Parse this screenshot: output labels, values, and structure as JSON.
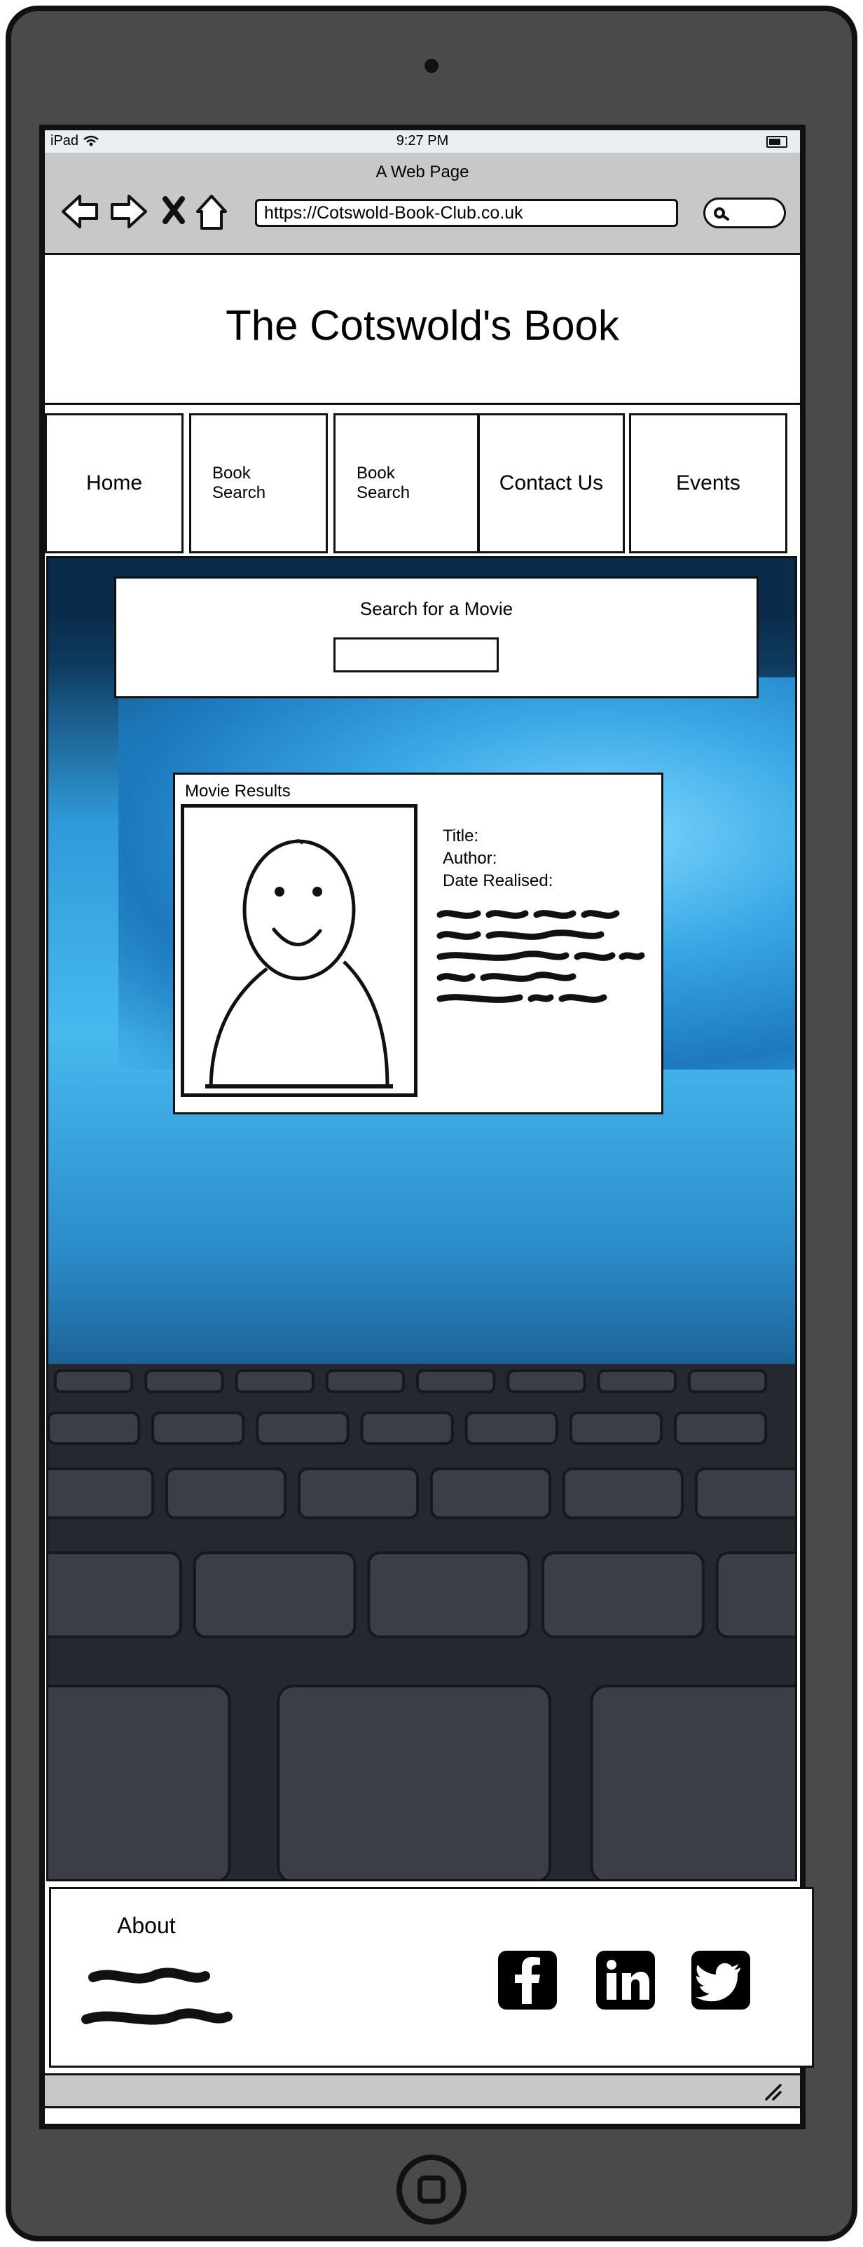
{
  "device": {
    "carrier": "iPad",
    "time": "9:27 PM"
  },
  "browser": {
    "page_title": "A Web Page",
    "url": "https://Cotswold-Book-Club.co.uk"
  },
  "site": {
    "title": "The Cotswold's  Book",
    "nav": [
      {
        "label": "Home"
      },
      {
        "label": "Book\nSearch"
      },
      {
        "label": "Book\nSearch"
      },
      {
        "label": "Contact Us"
      },
      {
        "label": "Events"
      }
    ]
  },
  "search": {
    "label": "Search for a Movie",
    "input_value": ""
  },
  "results": {
    "title": "Movie Results",
    "fields": [
      "Title:",
      "Author:",
      "Date Realised:"
    ]
  },
  "footer": {
    "about_label": "About"
  },
  "icons": {
    "back": "arrow-left-icon",
    "forward": "arrow-right-icon",
    "stop": "close-icon",
    "home": "home-icon",
    "search": "search-icon",
    "wifi": "wifi-icon",
    "battery": "battery-icon",
    "facebook": "facebook-icon",
    "linkedin": "linkedin-icon",
    "twitter": "twitter-icon",
    "resize": "resize-grip-icon",
    "placeholder_image": "avatar-placeholder-icon"
  },
  "colors": {
    "device_frame": "#4a4a4a",
    "browser_chrome": "#c8c8c8",
    "cinema_blue": "#47b9ef"
  }
}
